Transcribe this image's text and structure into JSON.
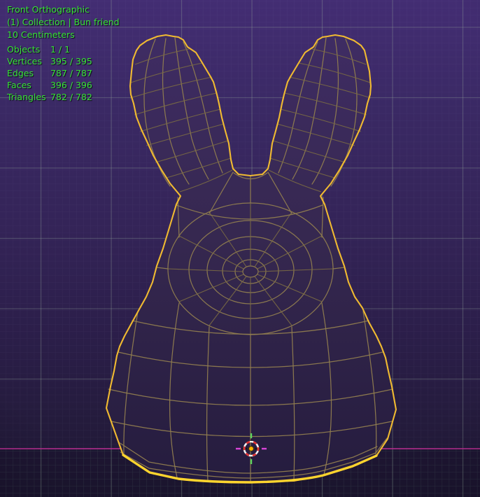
{
  "viewport": {
    "view_name": "Front Orthographic",
    "context_breadcrumb": "(1) Collection | Bun friend",
    "grid_scale": "10 Centimeters",
    "object_name": "Bun friend",
    "stats": [
      {
        "label": "Objects",
        "value": "1 / 1"
      },
      {
        "label": "Vertices",
        "value": "395 / 395"
      },
      {
        "label": "Edges",
        "value": "787 / 787"
      },
      {
        "label": "Faces",
        "value": "396 / 396"
      },
      {
        "label": "Triangles",
        "value": "782 / 782"
      }
    ]
  },
  "colors": {
    "overlay_text_green": "#38e238",
    "selection_outline_yellow": "#f0ba31",
    "selected_edge_bright_yellow": "#ffd52e",
    "wireframe_tan": "#8f7c4f",
    "x_axis_pink": "#bb2e92",
    "background_top_purple": "#432d73",
    "background_bottom_purple": "#1e1734",
    "cursor_red": "#e03030",
    "cursor_white": "#f2f2f2",
    "origin_dot_orange": "#ffb400",
    "cursor_tick_green": "#5fd75f",
    "cursor_tick_magenta": "#d944d9"
  }
}
